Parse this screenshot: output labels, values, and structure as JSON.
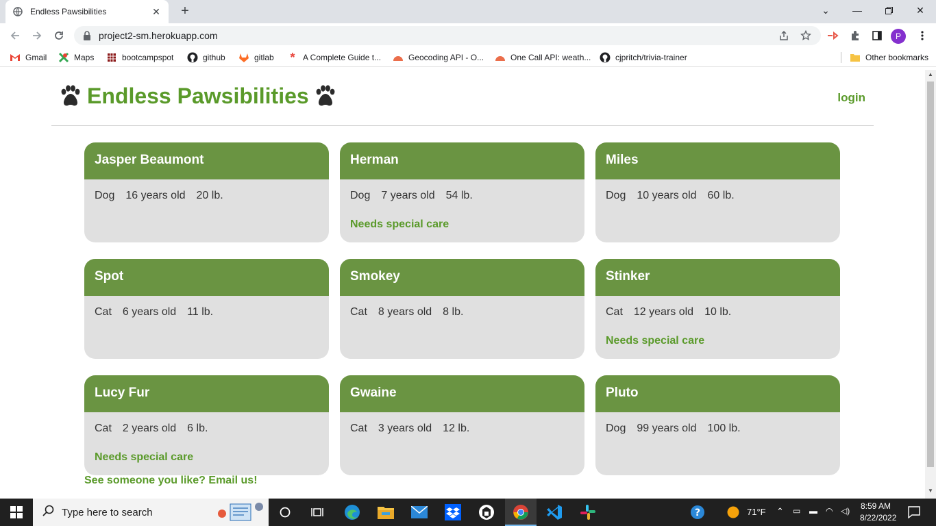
{
  "browser": {
    "tab_title": "Endless Pawsibilities",
    "url": "project2-sm.herokuapp.com",
    "profile_initial": "P",
    "bookmarks": [
      "Gmail",
      "Maps",
      "bootcampspot",
      "github",
      "gitlab",
      "A Complete Guide t...",
      "Geocoding API - O...",
      "One Call API: weath...",
      "cjpritch/trivia-trainer"
    ],
    "other_bookmarks": "Other bookmarks"
  },
  "header": {
    "title": "Endless Pawsibilities",
    "login": "login"
  },
  "pets": [
    {
      "name": "Jasper Beaumont",
      "species": "Dog",
      "age": "16 years old",
      "weight": "20 lb.",
      "special": ""
    },
    {
      "name": "Herman",
      "species": "Dog",
      "age": "7 years old",
      "weight": "54 lb.",
      "special": "Needs special care"
    },
    {
      "name": "Miles",
      "species": "Dog",
      "age": "10 years old",
      "weight": "60 lb.",
      "special": ""
    },
    {
      "name": "Spot",
      "species": "Cat",
      "age": "6 years old",
      "weight": "11 lb.",
      "special": ""
    },
    {
      "name": "Smokey",
      "species": "Cat",
      "age": "8 years old",
      "weight": "8 lb.",
      "special": ""
    },
    {
      "name": "Stinker",
      "species": "Cat",
      "age": "12 years old",
      "weight": "10 lb.",
      "special": "Needs special care"
    },
    {
      "name": "Lucy Fur",
      "species": "Cat",
      "age": "2 years old",
      "weight": "6 lb.",
      "special": "Needs special care"
    },
    {
      "name": "Gwaine",
      "species": "Cat",
      "age": "3 years old",
      "weight": "12 lb.",
      "special": ""
    },
    {
      "name": "Pluto",
      "species": "Dog",
      "age": "99 years old",
      "weight": "100 lb.",
      "special": ""
    }
  ],
  "footer": {
    "cta": "See someone you like? Email us!"
  },
  "taskbar": {
    "search_placeholder": "Type here to search",
    "temperature": "71°F",
    "time": "8:59 AM",
    "date": "8/22/2022"
  },
  "colors": {
    "brand_green": "#5a9a2a",
    "card_header": "#6a9442",
    "card_body": "#e0e0e0"
  }
}
